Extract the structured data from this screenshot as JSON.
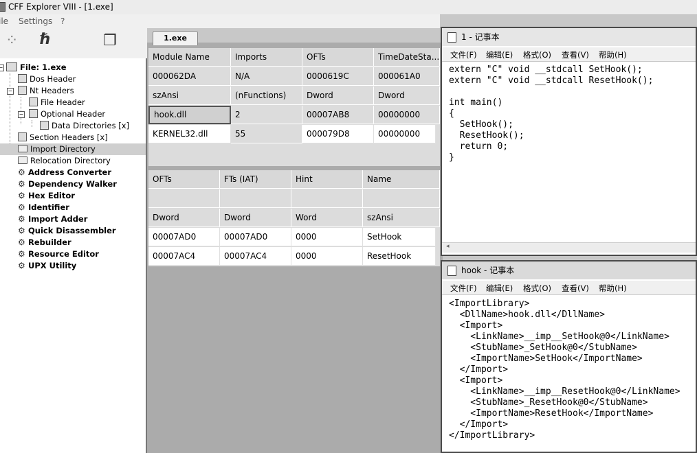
{
  "window": {
    "title": "CFF Explorer VIII - [1.exe]"
  },
  "menu": {
    "file": "ile",
    "settings": "Settings",
    "help": "?"
  },
  "toolbar": {
    "icons": [
      "open-icon",
      "hook-icon",
      "windows-icon"
    ]
  },
  "tree": {
    "items": [
      {
        "label": "File: 1.exe"
      },
      {
        "label": "Dos Header"
      },
      {
        "label": "Nt Headers"
      },
      {
        "label": "File Header"
      },
      {
        "label": "Optional Header"
      },
      {
        "label": "Data Directories [x]"
      },
      {
        "label": "Section Headers [x]"
      },
      {
        "label": "Import Directory"
      },
      {
        "label": "Relocation Directory"
      },
      {
        "label": "Address Converter"
      },
      {
        "label": "Dependency Walker"
      },
      {
        "label": "Hex Editor"
      },
      {
        "label": "Identifier"
      },
      {
        "label": "Import Adder"
      },
      {
        "label": "Quick Disassembler"
      },
      {
        "label": "Rebuilder"
      },
      {
        "label": "Resource Editor"
      },
      {
        "label": "UPX Utility"
      }
    ]
  },
  "tab": {
    "label": "1.exe"
  },
  "modules": {
    "headers": [
      "Module Name",
      "Imports",
      "OFTs",
      "TimeDateSta..."
    ],
    "rows": [
      [
        "000062DA",
        "N/A",
        "0000619C",
        "000061A0"
      ],
      [
        "szAnsi",
        "(nFunctions)",
        "Dword",
        "Dword"
      ],
      [
        "hook.dll",
        "2",
        "00007AB8",
        "00000000"
      ],
      [
        "KERNEL32.dll",
        "55",
        "000079D8",
        "00000000"
      ]
    ]
  },
  "functions": {
    "headers": [
      "OFTs",
      "FTs (IAT)",
      "Hint",
      "Name"
    ],
    "rows": [
      [
        "",
        "",
        "",
        ""
      ],
      [
        "Dword",
        "Dword",
        "Word",
        "szAnsi"
      ],
      [
        "00007AD0",
        "00007AD0",
        "0000",
        "SetHook"
      ],
      [
        "00007AC4",
        "00007AC4",
        "0000",
        "ResetHook"
      ]
    ]
  },
  "notepad1": {
    "title": "1 - 记事本",
    "menu": [
      "文件(F)",
      "编辑(E)",
      "格式(O)",
      "查看(V)",
      "帮助(H)"
    ],
    "lines": [
      "extern \"C\" void __stdcall SetHook();",
      "extern \"C\" void __stdcall ResetHook();",
      "",
      "int main()",
      "{",
      "  SetHook();",
      "  ResetHook();",
      "  return 0;",
      "}"
    ]
  },
  "notepad2": {
    "title": "hook - 记事本",
    "menu": [
      "文件(F)",
      "编辑(E)",
      "格式(O)",
      "查看(V)",
      "帮助(H)"
    ],
    "lines": [
      "<ImportLibrary>",
      "  <DllName>hook.dll</DllName>",
      "  <Import>",
      "    <LinkName>__imp__SetHook@0</LinkName>",
      "    <StubName>_SetHook@0</StubName>",
      "    <ImportName>SetHook</ImportName>",
      "  </Import>",
      "  <Import>",
      "    <LinkName>__imp__ResetHook@0</LinkName>",
      "    <StubName>_ResetHook@0</StubName>",
      "    <ImportName>ResetHook</ImportName>",
      "  </Import>",
      "</ImportLibrary>"
    ]
  }
}
